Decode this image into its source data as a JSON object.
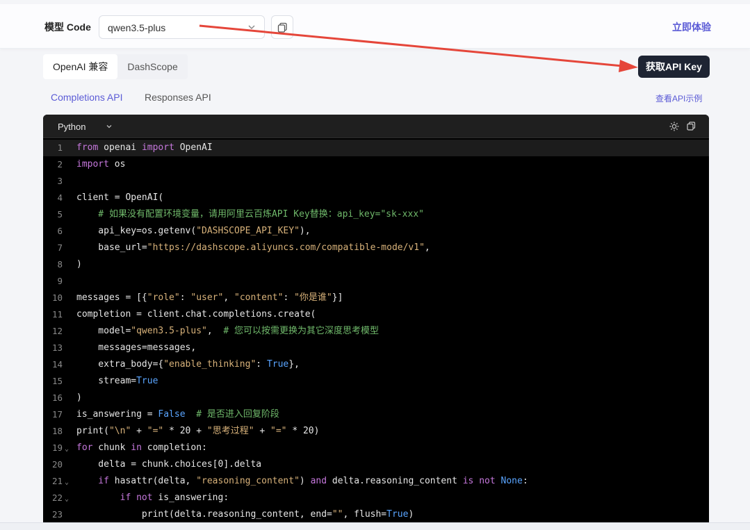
{
  "header": {
    "model_label": "模型 Code",
    "model_value": "qwen3.5-plus",
    "try_label": "立即体验"
  },
  "compat_tabs": [
    {
      "label": "OpenAI 兼容",
      "active": true
    },
    {
      "label": "DashScope",
      "active": false
    }
  ],
  "api_key_button": "获取API Key",
  "api_tabs": [
    {
      "label": "Completions API",
      "active": true
    },
    {
      "label": "Responses API",
      "active": false
    }
  ],
  "example_link": "查看API示例",
  "code": {
    "language": "Python",
    "lines": [
      {
        "n": "1",
        "fold": "",
        "parts": [
          [
            "k",
            "from"
          ],
          [
            "",
            " openai "
          ],
          [
            "k",
            "import"
          ],
          [
            "",
            " OpenAI"
          ]
        ]
      },
      {
        "n": "2",
        "fold": "",
        "parts": [
          [
            "k",
            "import"
          ],
          [
            "",
            " os"
          ]
        ]
      },
      {
        "n": "3",
        "fold": "",
        "parts": []
      },
      {
        "n": "4",
        "fold": "",
        "parts": [
          [
            "",
            "client = OpenAI("
          ]
        ]
      },
      {
        "n": "5",
        "fold": "",
        "parts": [
          [
            "c",
            "    # 如果没有配置环境变量，请用阿里云百炼API Key替换：api_key=\"sk-xxx\""
          ]
        ]
      },
      {
        "n": "6",
        "fold": "",
        "parts": [
          [
            "",
            "    api_key=os.getenv("
          ],
          [
            "str",
            "\"DASHSCOPE_API_KEY\""
          ],
          [
            "",
            "),"
          ]
        ]
      },
      {
        "n": "7",
        "fold": "",
        "parts": [
          [
            "",
            "    base_url="
          ],
          [
            "str",
            "\"https://dashscope.aliyuncs.com/compatible-mode/v1\""
          ],
          [
            "",
            ","
          ]
        ]
      },
      {
        "n": "8",
        "fold": "",
        "parts": [
          [
            "",
            ")"
          ]
        ]
      },
      {
        "n": "9",
        "fold": "",
        "parts": []
      },
      {
        "n": "10",
        "fold": "",
        "parts": [
          [
            "",
            "messages = [{"
          ],
          [
            "str",
            "\"role\""
          ],
          [
            "",
            ": "
          ],
          [
            "str",
            "\"user\""
          ],
          [
            "",
            ", "
          ],
          [
            "str",
            "\"content\""
          ],
          [
            "",
            ": "
          ],
          [
            "str",
            "\"你是谁\""
          ],
          [
            "",
            "}]"
          ]
        ]
      },
      {
        "n": "11",
        "fold": "",
        "parts": [
          [
            "",
            "completion = client.chat.completions.create("
          ]
        ]
      },
      {
        "n": "12",
        "fold": "",
        "parts": [
          [
            "",
            "    model="
          ],
          [
            "str",
            "\"qwen3.5-plus\""
          ],
          [
            "",
            ",  "
          ],
          [
            "c",
            "# 您可以按需更换为其它深度思考模型"
          ]
        ]
      },
      {
        "n": "13",
        "fold": "",
        "parts": [
          [
            "",
            "    messages=messages,"
          ]
        ]
      },
      {
        "n": "14",
        "fold": "",
        "parts": [
          [
            "",
            "    extra_body={"
          ],
          [
            "str",
            "\"enable_thinking\""
          ],
          [
            "",
            ": "
          ],
          [
            "t",
            "True"
          ],
          [
            "",
            "},"
          ]
        ]
      },
      {
        "n": "15",
        "fold": "",
        "parts": [
          [
            "",
            "    stream="
          ],
          [
            "t",
            "True"
          ]
        ]
      },
      {
        "n": "16",
        "fold": "",
        "parts": [
          [
            "",
            ")"
          ]
        ]
      },
      {
        "n": "17",
        "fold": "",
        "parts": [
          [
            "",
            "is_answering = "
          ],
          [
            "t",
            "False"
          ],
          [
            "",
            "  "
          ],
          [
            "c",
            "# 是否进入回复阶段"
          ]
        ]
      },
      {
        "n": "18",
        "fold": "",
        "parts": [
          [
            "",
            "print("
          ],
          [
            "str",
            "\"\\n\""
          ],
          [
            "",
            " + "
          ],
          [
            "str",
            "\"=\""
          ],
          [
            "",
            " * 20 + "
          ],
          [
            "str",
            "\"思考过程\""
          ],
          [
            "",
            " + "
          ],
          [
            "str",
            "\"=\""
          ],
          [
            "",
            " * 20)"
          ]
        ]
      },
      {
        "n": "19",
        "fold": "v",
        "parts": [
          [
            "k",
            "for"
          ],
          [
            "",
            " chunk "
          ],
          [
            "k",
            "in"
          ],
          [
            "",
            " completion:"
          ]
        ]
      },
      {
        "n": "20",
        "fold": "",
        "parts": [
          [
            "",
            "    delta = chunk.choices[0].delta"
          ]
        ]
      },
      {
        "n": "21",
        "fold": "v",
        "parts": [
          [
            "k",
            "    if"
          ],
          [
            "",
            " hasattr(delta, "
          ],
          [
            "str",
            "\"reasoning_content\""
          ],
          [
            "",
            ") "
          ],
          [
            "k",
            "and"
          ],
          [
            "",
            " delta.reasoning_content "
          ],
          [
            "k",
            "is not"
          ],
          [
            "",
            " "
          ],
          [
            "t",
            "None"
          ],
          [
            "",
            ":"
          ]
        ]
      },
      {
        "n": "22",
        "fold": "v",
        "parts": [
          [
            "k",
            "        if not"
          ],
          [
            "",
            " is_answering:"
          ]
        ]
      },
      {
        "n": "23",
        "fold": "",
        "parts": [
          [
            "",
            "            print(delta.reasoning_content, end="
          ],
          [
            "str",
            "\"\""
          ],
          [
            "",
            ", flush="
          ],
          [
            "t",
            "True"
          ],
          [
            "",
            ")"
          ]
        ]
      }
    ]
  },
  "colors": {
    "accent": "#5b5bd6",
    "dark_button": "#1e2433",
    "annotation_arrow": "#e5463a"
  }
}
